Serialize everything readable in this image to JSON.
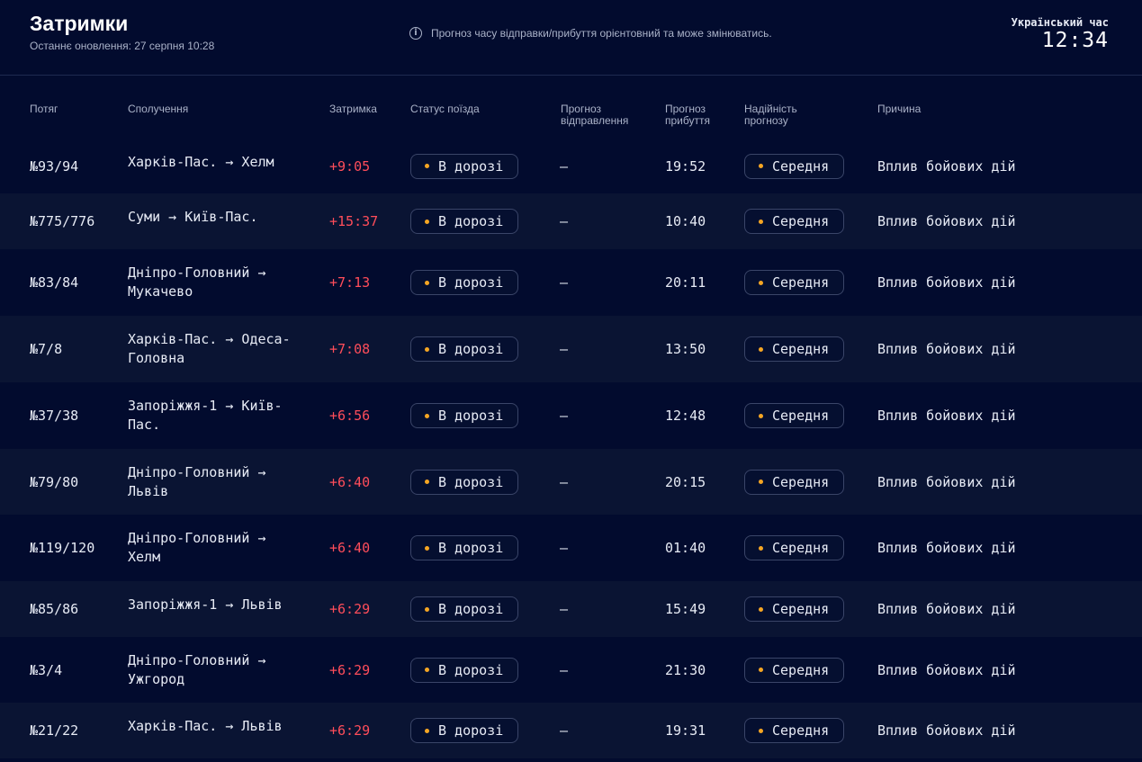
{
  "header": {
    "title": "Затримки",
    "updated": "Останнє оновлення: 27 серпня 10:28",
    "notice": "Прогноз часу відправки/прибуття орієнтовний та може змінюватись.",
    "info_icon": "info-circle-icon",
    "clock_label": "Український час",
    "clock_time": "12:34"
  },
  "columns": {
    "train": "Потяг",
    "route": "Сполучення",
    "delay": "Затримка",
    "status": "Статус поїзда",
    "departure_1": "Прогноз",
    "departure_2": "відправлення",
    "arrival_1": "Прогноз",
    "arrival_2": "прибуття",
    "reliability_1": "Надійність",
    "reliability_2": "прогнозу",
    "reason": "Причина"
  },
  "colors": {
    "background": "#020b2e",
    "row_alt": "#0a1433",
    "delay": "#ff4d5a",
    "status_dot": "#f5a623"
  },
  "rows": [
    {
      "train": "№93/94",
      "route": "Харків-Пас. → Хелм",
      "delay": "+9:05",
      "status": "В дорозі",
      "departure": "—",
      "arrival": "19:52",
      "reliability": "Середня",
      "reason": "Вплив бойових дій"
    },
    {
      "train": "№775/776",
      "route": "Суми → Київ-Пас.",
      "delay": "+15:37",
      "status": "В дорозі",
      "departure": "—",
      "arrival": "10:40",
      "reliability": "Середня",
      "reason": "Вплив бойових дій"
    },
    {
      "train": "№83/84",
      "route": "Дніпро-Головний → Мукачево",
      "delay": "+7:13",
      "status": "В дорозі",
      "departure": "—",
      "arrival": "20:11",
      "reliability": "Середня",
      "reason": "Вплив бойових дій"
    },
    {
      "train": "№7/8",
      "route": "Харків-Пас. → Одеса-Головна",
      "delay": "+7:08",
      "status": "В дорозі",
      "departure": "—",
      "arrival": "13:50",
      "reliability": "Середня",
      "reason": "Вплив бойових дій"
    },
    {
      "train": "№37/38",
      "route": "Запоріжжя-1 → Київ-Пас.",
      "delay": "+6:56",
      "status": "В дорозі",
      "departure": "—",
      "arrival": "12:48",
      "reliability": "Середня",
      "reason": "Вплив бойових дій"
    },
    {
      "train": "№79/80",
      "route": "Дніпро-Головний → Львів",
      "delay": "+6:40",
      "status": "В дорозі",
      "departure": "—",
      "arrival": "20:15",
      "reliability": "Середня",
      "reason": "Вплив бойових дій"
    },
    {
      "train": "№119/120",
      "route": "Дніпро-Головний → Хелм",
      "delay": "+6:40",
      "status": "В дорозі",
      "departure": "—",
      "arrival": "01:40",
      "reliability": "Середня",
      "reason": "Вплив бойових дій"
    },
    {
      "train": "№85/86",
      "route": "Запоріжжя-1 → Львів",
      "delay": "+6:29",
      "status": "В дорозі",
      "departure": "—",
      "arrival": "15:49",
      "reliability": "Середня",
      "reason": "Вплив бойових дій"
    },
    {
      "train": "№3/4",
      "route": "Дніпро-Головний → Ужгород",
      "delay": "+6:29",
      "status": "В дорозі",
      "departure": "—",
      "arrival": "21:30",
      "reliability": "Середня",
      "reason": "Вплив бойових дій"
    },
    {
      "train": "№21/22",
      "route": "Харків-Пас. → Львів",
      "delay": "+6:29",
      "status": "В дорозі",
      "departure": "—",
      "arrival": "19:31",
      "reliability": "Середня",
      "reason": "Вплив бойових дій"
    }
  ]
}
